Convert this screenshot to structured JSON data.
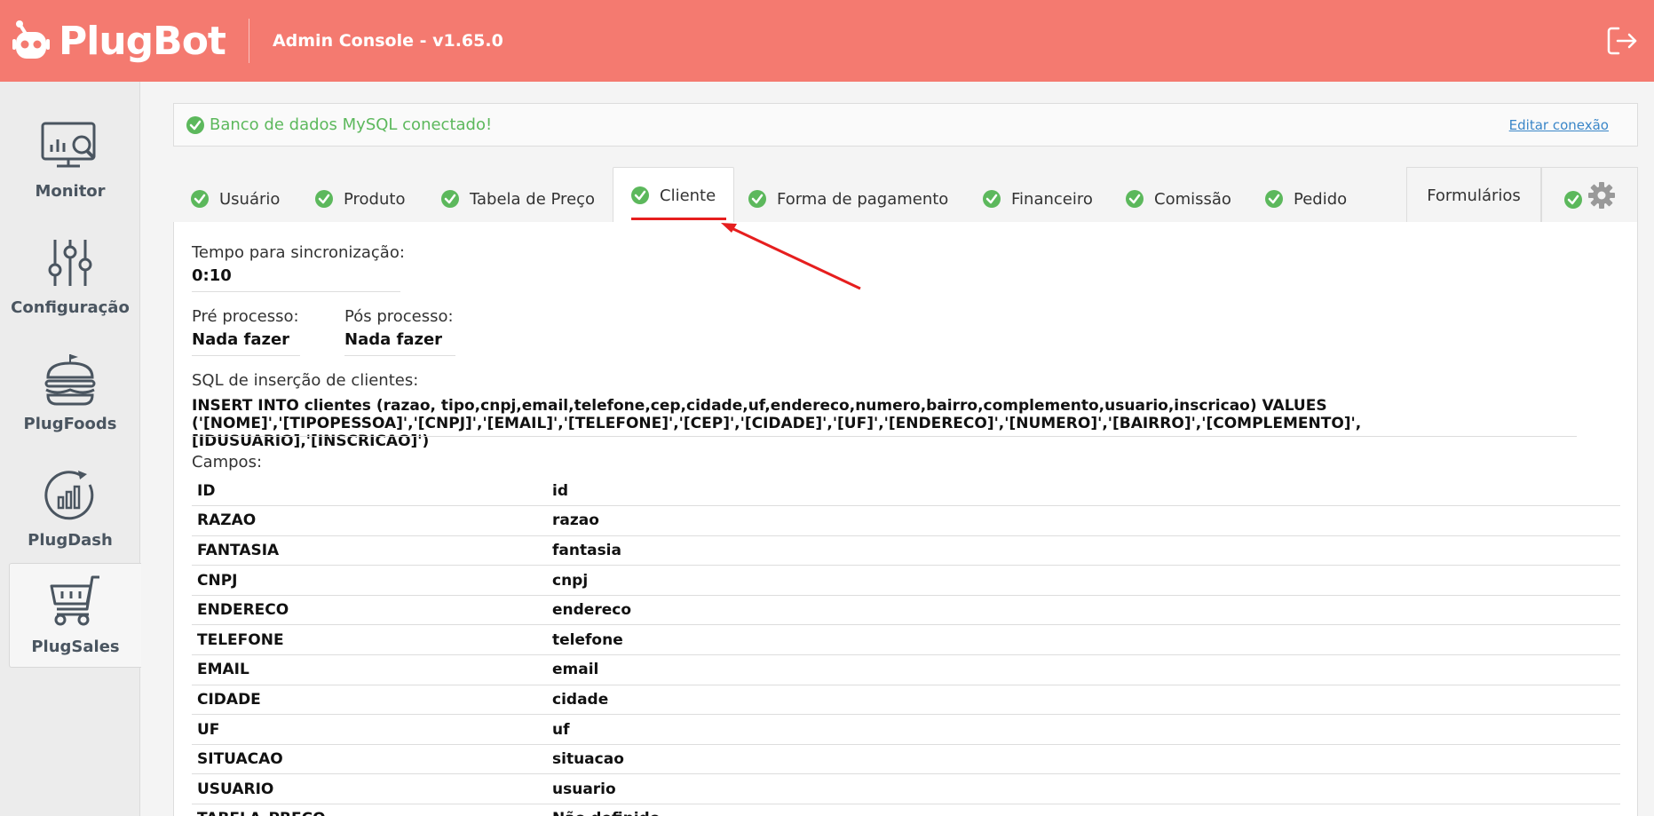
{
  "header": {
    "app_name": "PlugBot",
    "title": "Admin Console - v1.65.0",
    "brand_color": "#f47a70"
  },
  "sidebar": {
    "items": [
      {
        "label": "Monitor",
        "icon": "monitor-chart-icon"
      },
      {
        "label": "Configuração",
        "icon": "sliders-icon"
      },
      {
        "label": "PlugFoods",
        "icon": "burger-icon"
      },
      {
        "label": "PlugDash",
        "icon": "dashboard-chart-icon"
      },
      {
        "label": "PlugSales",
        "icon": "shopping-cart-icon"
      }
    ],
    "active": "PlugSales"
  },
  "alert": {
    "text": "Banco de dados MySQL conectado!",
    "link": "Editar conexão",
    "color": "#5cb85c"
  },
  "tabs": {
    "items": [
      "Usuário",
      "Produto",
      "Tabela de Preço",
      "Cliente",
      "Forma de pagamento",
      "Financeiro",
      "Comissão",
      "Pedido"
    ],
    "active": "Cliente",
    "forms": "Formulários"
  },
  "form": {
    "sync_label": "Tempo para sincronização:",
    "sync_value": "0:10",
    "pre_label": "Pré processo:",
    "pre_value": "Nada fazer",
    "post_label": "Pós processo:",
    "post_value": "Nada fazer",
    "sql_label": "SQL de inserção de clientes:",
    "sql_line1": "INSERT INTO clientes (razao, tipo,cnpj,email,telefone,cep,cidade,uf,endereco,numero,bairro,complemento,usuario,inscricao) VALUES",
    "sql_line2": "('[NOME]','[TIPOPESSOA]','[CNPJ]','[EMAIL]','[TELEFONE]','[CEP]','[CIDADE]','[UF]','[ENDERECO]','[NUMERO]','[BAIRRO]','[COMPLEMENTO]',[IDUSUARIO],'[INSCRICAO]')",
    "campos_label": "Campos:"
  },
  "campos": [
    {
      "k": "ID",
      "v": "id"
    },
    {
      "k": "RAZAO",
      "v": "razao"
    },
    {
      "k": "FANTASIA",
      "v": "fantasia"
    },
    {
      "k": "CNPJ",
      "v": "cnpj"
    },
    {
      "k": "ENDERECO",
      "v": "endereco"
    },
    {
      "k": "TELEFONE",
      "v": "telefone"
    },
    {
      "k": "EMAIL",
      "v": "email"
    },
    {
      "k": "CIDADE",
      "v": "cidade"
    },
    {
      "k": "UF",
      "v": "uf"
    },
    {
      "k": "SITUACAO",
      "v": "situacao"
    },
    {
      "k": "USUARIO",
      "v": "usuario"
    },
    {
      "k": "TABELA_PRECO",
      "v": "Não definido"
    }
  ]
}
